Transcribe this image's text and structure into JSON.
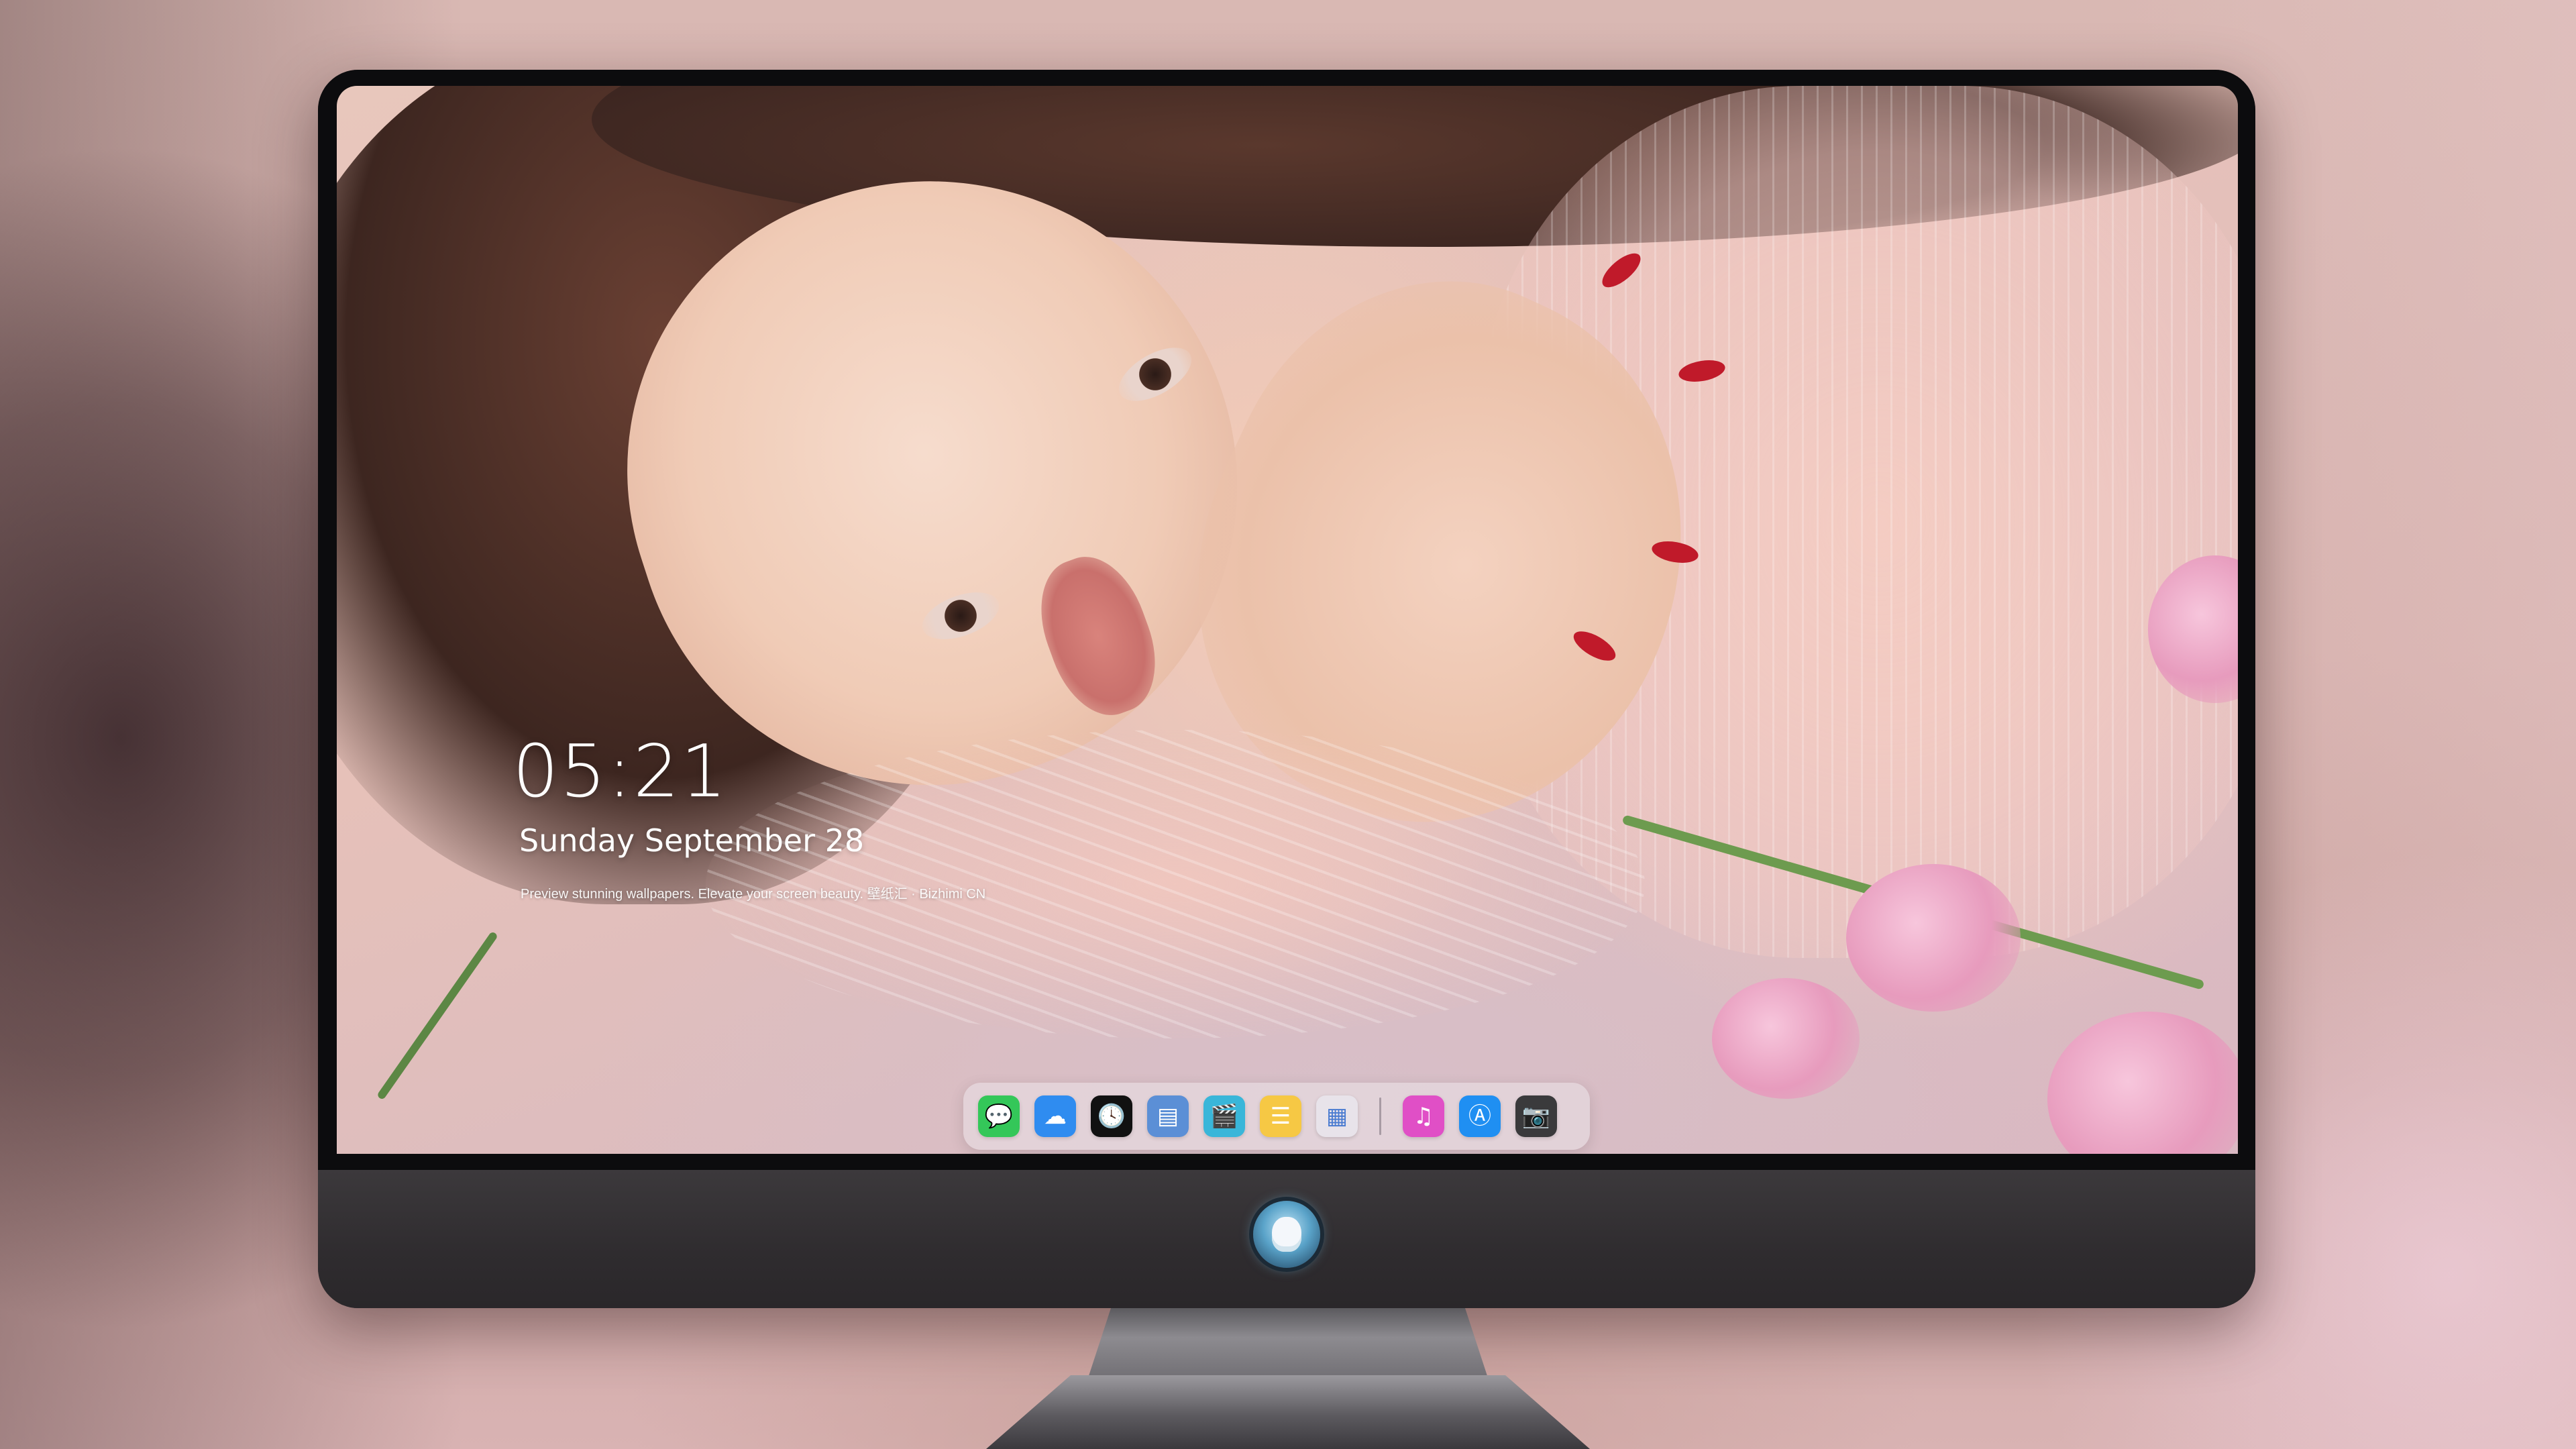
{
  "lock_screen": {
    "time": "05:21",
    "date": "Sunday September  28",
    "tagline": "Preview stunning wallpapers. Elevate your screen beauty. 壁纸汇 · Bizhimi CN"
  },
  "dock": {
    "apps": [
      {
        "name": "messages-icon",
        "glyph": "💬",
        "color": "#34c759"
      },
      {
        "name": "weather-icon",
        "glyph": "☁",
        "color": "#2f8cf0"
      },
      {
        "name": "clock-icon",
        "glyph": "🕓",
        "color": "#111111"
      },
      {
        "name": "preview-icon",
        "glyph": "▤",
        "color": "#5b8fd6"
      },
      {
        "name": "videos-icon",
        "glyph": "🎬",
        "color": "#39b6d9"
      },
      {
        "name": "notes-icon",
        "glyph": "☰",
        "color": "#f6c844"
      },
      {
        "name": "photo-booth-icon",
        "glyph": "▦",
        "color": "#e8e3ea"
      }
    ],
    "recent_apps": [
      {
        "name": "music-icon",
        "glyph": "♫",
        "color": "#e04fc6"
      },
      {
        "name": "app-store-icon",
        "glyph": "Ⓐ",
        "color": "#1f8ff2"
      },
      {
        "name": "camera-icon",
        "glyph": "📷",
        "color": "#3a3a3c"
      }
    ]
  }
}
